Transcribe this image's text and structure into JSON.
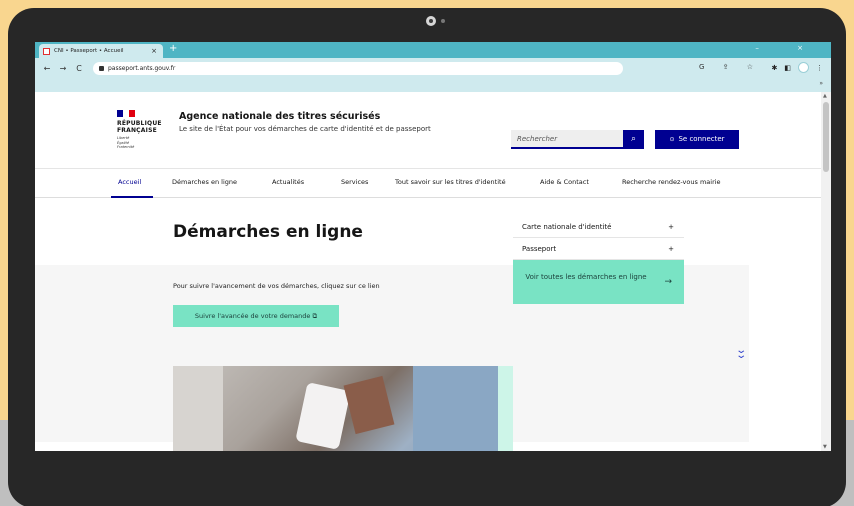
{
  "browser": {
    "tab_title": "CNI • Passeport • Accueil",
    "tab_close": "×",
    "new_tab": "+",
    "window_controls": "–  ×",
    "back": "←",
    "forward": "→",
    "reload": "C",
    "url": "passeport.ants.gouv.fr",
    "address_icons": "G ⇪ ☆",
    "bookmark_chevron": "»"
  },
  "header": {
    "republic_line1": "RÉPUBLIQUE",
    "republic_line2": "FRANÇAISE",
    "motto": [
      "Liberté",
      "Égalité",
      "Fraternité"
    ],
    "site_title": "Agence nationale des titres sécurisés",
    "site_tagline": "Le site de l'État pour vos démarches de carte d'identité et de passeport",
    "search_placeholder": "Rechercher",
    "login_label": "Se connecter"
  },
  "nav": {
    "items": [
      "Accueil",
      "Démarches en ligne",
      "Actualités",
      "Services",
      "Tout savoir sur les titres d'identité",
      "Aide & Contact",
      "Recherche rendez-vous mairie"
    ]
  },
  "main": {
    "title": "Démarches en ligne",
    "follow_text": "Pour suivre l'avancement de vos démarches, cliquez sur ce lien",
    "follow_button": "Suivre l'avancée de votre demande ⧉"
  },
  "side_menu": {
    "items": [
      {
        "label": "Carte nationale d'identité",
        "icon": "+"
      },
      {
        "label": "Passeport",
        "icon": "+"
      }
    ],
    "cta": "Voir toutes les démarches en ligne",
    "cta_arrow": "→"
  },
  "colors": {
    "brand_blue": "#000091",
    "accent_green": "#79e3c4",
    "chrome_teal": "#4fb5c4"
  }
}
